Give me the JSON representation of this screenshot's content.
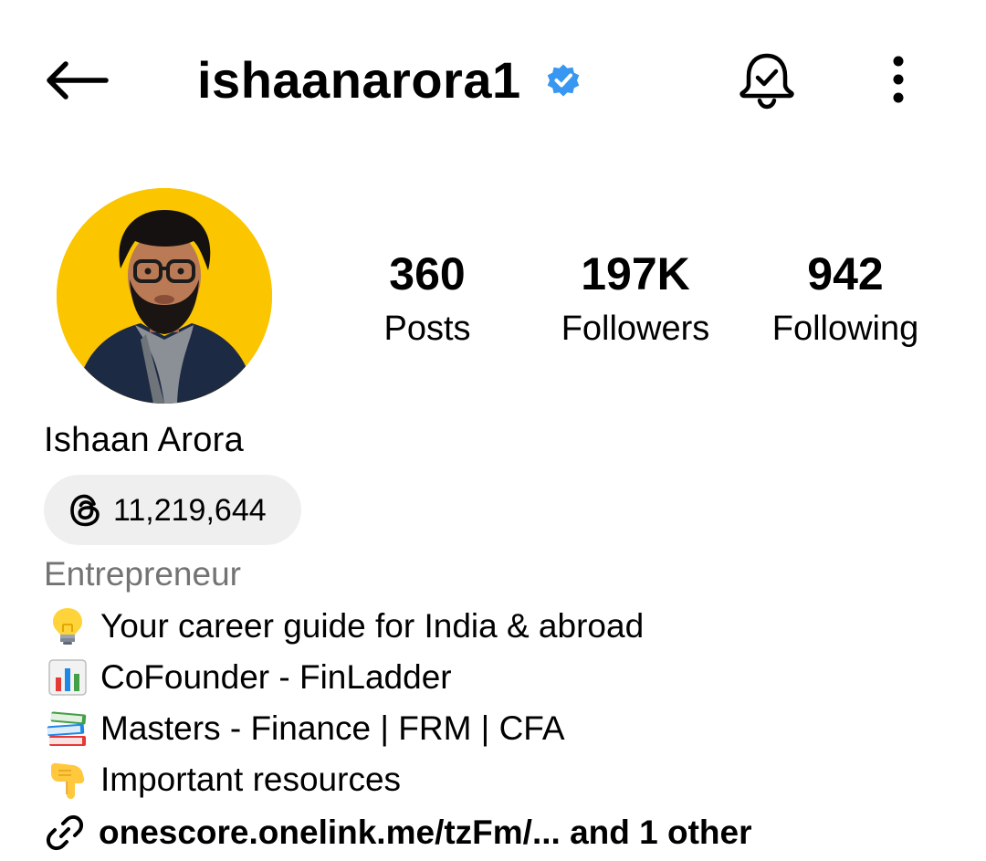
{
  "header": {
    "username": "ishaanarora1",
    "verified_color": "#3897f0",
    "icons": {
      "back": "back-arrow-icon",
      "verified": "verified-badge-icon",
      "notifications": "bell-check-icon",
      "more": "more-vertical-icon"
    }
  },
  "profile": {
    "avatar_bg": "#fbc500",
    "stats": [
      {
        "value": "360",
        "label": "Posts"
      },
      {
        "value": "197K",
        "label": "Followers"
      },
      {
        "value": "942",
        "label": "Following"
      }
    ],
    "display_name": "Ishaan Arora",
    "threads": {
      "icon": "threads-icon",
      "count": "11,219,644"
    },
    "category": "Entrepreneur",
    "bio": [
      {
        "emoji": "lightbulb-emoji",
        "text": "Your career guide for India & abroad"
      },
      {
        "emoji": "bar-chart-emoji",
        "text": "CoFounder - FinLadder"
      },
      {
        "emoji": "books-emoji",
        "text": "Masters - Finance | FRM | CFA"
      },
      {
        "emoji": "pointing-down-emoji",
        "text": "Important resources"
      }
    ],
    "link": {
      "icon": "link-icon",
      "text": "onescore.onelink.me/tzFm/... and 1 other"
    }
  }
}
